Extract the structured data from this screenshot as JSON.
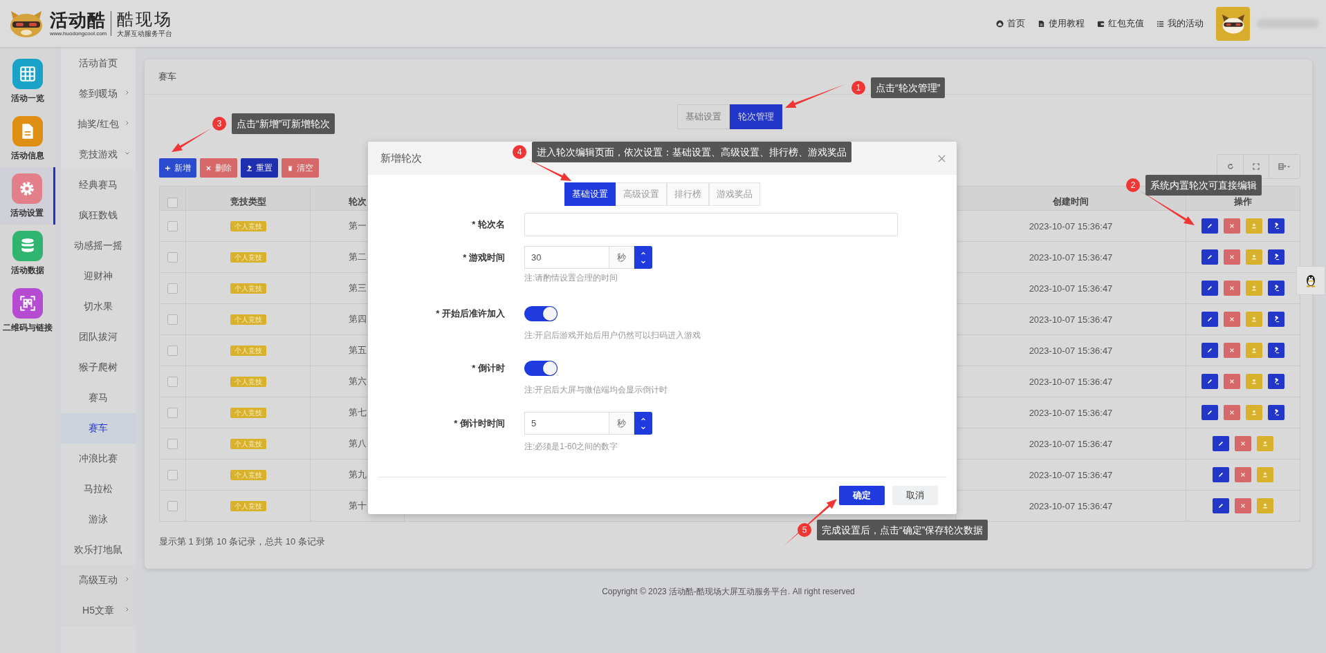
{
  "header": {
    "logo": {
      "brand": "活动酷",
      "url": "www.huodongcool.com",
      "product": "酷现场",
      "tagline": "大屏互动服务平台"
    },
    "nav": [
      {
        "kind": "home",
        "label": "首页"
      },
      {
        "kind": "doc",
        "label": "使用教程"
      },
      {
        "kind": "wallet",
        "label": "红包充值"
      },
      {
        "kind": "list",
        "label": "我的活动"
      }
    ]
  },
  "rail": [
    {
      "kind": "grid",
      "label": "活动一览",
      "color": "#1ba2c9",
      "selected": false
    },
    {
      "kind": "doc",
      "label": "活动信息",
      "color": "#df8e14",
      "selected": false
    },
    {
      "kind": "gear",
      "label": "活动设置",
      "color": "#e27f88",
      "selected": true
    },
    {
      "kind": "database",
      "label": "活动数据",
      "color": "#2fb570",
      "selected": false
    },
    {
      "kind": "qr",
      "label": "二维码与链接",
      "color": "#b54bd0",
      "selected": false
    }
  ],
  "subnav": [
    {
      "kind": "link",
      "label": "活动首页",
      "selected": false
    },
    {
      "kind": "group",
      "label": "签到暖场",
      "selected": false,
      "expanded": false
    },
    {
      "kind": "group",
      "label": "抽奖/红包",
      "selected": false,
      "expanded": false
    },
    {
      "kind": "group",
      "label": "竞技游戏",
      "selected": false,
      "expanded": true,
      "children": [
        {
          "label": "经典赛马",
          "selected": false
        },
        {
          "label": "疯狂数钱",
          "selected": false
        },
        {
          "label": "动感摇一摇",
          "selected": false
        },
        {
          "label": "迎财神",
          "selected": false
        },
        {
          "label": "切水果",
          "selected": false
        },
        {
          "label": "团队拔河",
          "selected": false
        },
        {
          "label": "猴子爬树",
          "selected": false
        },
        {
          "label": "赛马",
          "selected": false
        },
        {
          "label": "赛车",
          "selected": true
        },
        {
          "label": "冲浪比赛",
          "selected": false
        },
        {
          "label": "马拉松",
          "selected": false
        },
        {
          "label": "游泳",
          "selected": false
        },
        {
          "label": "欢乐打地鼠",
          "selected": false
        }
      ]
    },
    {
      "kind": "group",
      "label": "高级互动",
      "selected": false,
      "expanded": false
    },
    {
      "kind": "group",
      "label": "H5文章",
      "selected": false,
      "expanded": false
    }
  ],
  "card": {
    "title": "赛车",
    "tabs": [
      {
        "label": "基础设置",
        "selected": false
      },
      {
        "label": "轮次管理",
        "selected": true
      }
    ],
    "toolbar": [
      {
        "kind": "add",
        "label": "新增"
      },
      {
        "kind": "delete",
        "label": "删除"
      },
      {
        "kind": "reset",
        "label": "重置"
      },
      {
        "kind": "clear",
        "label": "清空"
      }
    ],
    "tools": [
      {
        "kind": "refresh"
      },
      {
        "kind": "fullscreen"
      },
      {
        "kind": "columns"
      }
    ],
    "table": {
      "select_all_checked": false,
      "columns": [
        {
          "kind": "type",
          "label": "竞技类型"
        },
        {
          "kind": "round",
          "label": "轮次"
        },
        {
          "kind": "created",
          "label": "创建时间"
        },
        {
          "kind": "actions",
          "label": "操作"
        }
      ],
      "rows": [
        {
          "checked": false,
          "type": "个人竞技",
          "round": "第一",
          "created": "2023-10-07 15:36:47",
          "actions": [
            {
              "kind": "edit"
            },
            {
              "kind": "delete"
            },
            {
              "kind": "user"
            },
            {
              "kind": "reset"
            }
          ]
        },
        {
          "checked": false,
          "type": "个人竞技",
          "round": "第二",
          "created": "2023-10-07 15:36:47",
          "actions": [
            {
              "kind": "edit"
            },
            {
              "kind": "delete"
            },
            {
              "kind": "user"
            },
            {
              "kind": "reset"
            }
          ]
        },
        {
          "checked": false,
          "type": "个人竞技",
          "round": "第三",
          "created": "2023-10-07 15:36:47",
          "actions": [
            {
              "kind": "edit"
            },
            {
              "kind": "delete"
            },
            {
              "kind": "user"
            },
            {
              "kind": "reset"
            }
          ]
        },
        {
          "checked": false,
          "type": "个人竞技",
          "round": "第四",
          "created": "2023-10-07 15:36:47",
          "actions": [
            {
              "kind": "edit"
            },
            {
              "kind": "delete"
            },
            {
              "kind": "user"
            },
            {
              "kind": "reset"
            }
          ]
        },
        {
          "checked": false,
          "type": "个人竞技",
          "round": "第五",
          "created": "2023-10-07 15:36:47",
          "actions": [
            {
              "kind": "edit"
            },
            {
              "kind": "delete"
            },
            {
              "kind": "user"
            },
            {
              "kind": "reset"
            }
          ]
        },
        {
          "checked": false,
          "type": "个人竞技",
          "round": "第六",
          "created": "2023-10-07 15:36:47",
          "actions": [
            {
              "kind": "edit"
            },
            {
              "kind": "delete"
            },
            {
              "kind": "user"
            },
            {
              "kind": "reset"
            }
          ]
        },
        {
          "checked": false,
          "type": "个人竞技",
          "round": "第七",
          "created": "2023-10-07 15:36:47",
          "actions": [
            {
              "kind": "edit"
            },
            {
              "kind": "delete"
            },
            {
              "kind": "user"
            },
            {
              "kind": "reset"
            }
          ]
        },
        {
          "checked": false,
          "type": "个人竞技",
          "round": "第八",
          "created": "2023-10-07 15:36:47",
          "actions": [
            {
              "kind": "edit"
            },
            {
              "kind": "delete"
            },
            {
              "kind": "user"
            }
          ]
        },
        {
          "checked": false,
          "type": "个人竞技",
          "round": "第九",
          "created": "2023-10-07 15:36:47",
          "actions": [
            {
              "kind": "edit"
            },
            {
              "kind": "delete"
            },
            {
              "kind": "user"
            }
          ]
        },
        {
          "checked": false,
          "type": "个人竞技",
          "round": "第十",
          "created": "2023-10-07 15:36:47",
          "actions": [
            {
              "kind": "edit"
            },
            {
              "kind": "delete"
            },
            {
              "kind": "user"
            }
          ]
        }
      ]
    },
    "summary": "显示第 1 到第 10 条记录，总共 10 条记录"
  },
  "copyright": "Copyright © 2023 活动酷-酷现场大屏互动服务平台. All right reserved",
  "modal": {
    "title": "新增轮次",
    "tabs": [
      {
        "label": "基础设置",
        "selected": true
      },
      {
        "label": "高级设置",
        "selected": false
      },
      {
        "label": "排行榜",
        "selected": false
      },
      {
        "label": "游戏奖品",
        "selected": false
      }
    ],
    "fields": [
      {
        "kind": "text",
        "label": "* 轮次名"
      },
      {
        "kind": "number",
        "label": "* 游戏时间",
        "value": "30",
        "unit": "秒",
        "hint": "注:请酌情设置合理的时间"
      },
      {
        "kind": "switch",
        "label": "* 开始后准许加入",
        "on": true,
        "hint": "注:开启后游戏开始后用户仍然可以扫码进入游戏"
      },
      {
        "kind": "switch",
        "label": "* 倒计时",
        "on": true,
        "hint": "注:开启后大屏与微信端均会显示倒计时"
      },
      {
        "kind": "number",
        "label": "* 倒计时时间",
        "value": "5",
        "unit": "秒",
        "hint": "注:必须是1-60之间的数字"
      }
    ],
    "buttons": [
      {
        "kind": "primary",
        "label": "确定"
      },
      {
        "kind": "default",
        "label": "取消"
      }
    ]
  },
  "callouts": [
    {
      "number": "1",
      "text": "点击“轮次管理”"
    },
    {
      "number": "2",
      "text": "系统内置轮次可直接编辑"
    },
    {
      "number": "3",
      "text": "点击“新增”可新增轮次"
    },
    {
      "number": "4",
      "text": "进入轮次编辑页面，依次设置：基础设置、高级设置、排行榜、游戏奖品"
    },
    {
      "number": "5",
      "text": "完成设置后，点击“确定”保存轮次数据"
    }
  ]
}
